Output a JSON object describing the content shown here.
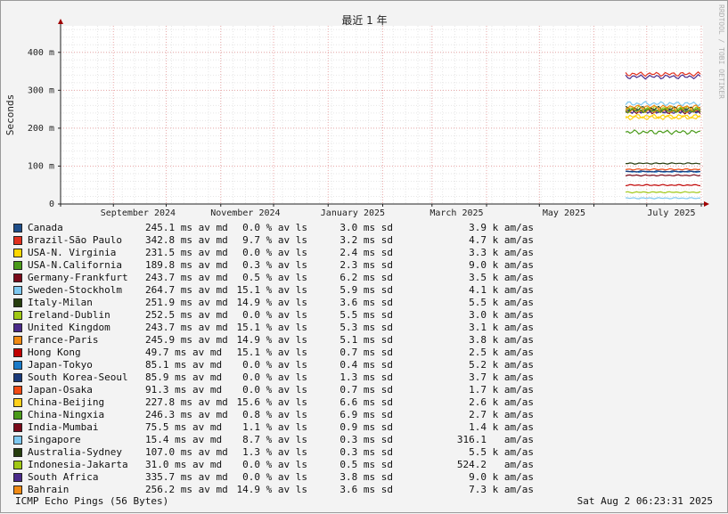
{
  "chart_data": {
    "type": "line",
    "title": "最近 1 年",
    "ylabel": "Seconds",
    "watermark": "RRDTOOL / TOBI OETIKER",
    "ylim": [
      0,
      0.47
    ],
    "yticks": [
      {
        "v": 0,
        "label": "0"
      },
      {
        "v": 0.1,
        "label": "100 m"
      },
      {
        "v": 0.2,
        "label": "200 m"
      },
      {
        "v": 0.3,
        "label": "300 m"
      },
      {
        "v": 0.4,
        "label": "400 m"
      }
    ],
    "xlim": [
      "2024-08-02",
      "2025-08-02"
    ],
    "xticks": [
      {
        "date": "2024-09-15",
        "label": "September 2024"
      },
      {
        "date": "2024-11-15",
        "label": "November 2024"
      },
      {
        "date": "2025-01-15",
        "label": "January 2025"
      },
      {
        "date": "2025-03-15",
        "label": "March 2025"
      },
      {
        "date": "2025-05-15",
        "label": "May 2025"
      },
      {
        "date": "2025-07-15",
        "label": "July 2025"
      }
    ],
    "data_start": "2025-06-19",
    "series": [
      {
        "name": "Canada",
        "color": "#1f4e8a",
        "value": 0.2451
      },
      {
        "name": "Brazil-São Paulo",
        "color": "#e0301e",
        "value": 0.3428
      },
      {
        "name": "USA-N. Virginia",
        "color": "#ffd700",
        "value": 0.2315
      },
      {
        "name": "USA-N.California",
        "color": "#4a9a1a",
        "value": 0.1898
      },
      {
        "name": "Germany-Frankfurt",
        "color": "#7a0a1a",
        "value": 0.2437
      },
      {
        "name": "Sweden-Stockholm",
        "color": "#7ec8f0",
        "value": 0.2647
      },
      {
        "name": "Italy-Milan",
        "color": "#263d0e",
        "value": 0.2519
      },
      {
        "name": "Ireland-Dublin",
        "color": "#a0c814",
        "value": 0.2525
      },
      {
        "name": "United Kingdom",
        "color": "#4a2a8a",
        "value": 0.2437
      },
      {
        "name": "France-Paris",
        "color": "#f08a14",
        "value": 0.2459
      },
      {
        "name": "Hong Kong",
        "color": "#c00000",
        "value": 0.0497
      },
      {
        "name": "Japan-Tokyo",
        "color": "#1a7ac8",
        "value": 0.0851
      },
      {
        "name": "South Korea-Seoul",
        "color": "#1a3a7a",
        "value": 0.0859
      },
      {
        "name": "Japan-Osaka",
        "color": "#f04a14",
        "value": 0.0913
      },
      {
        "name": "China-Beijing",
        "color": "#ffd01a",
        "value": 0.2278
      },
      {
        "name": "China-Ningxia",
        "color": "#4a9a1a",
        "value": 0.2463
      },
      {
        "name": "India-Mumbai",
        "color": "#7a0a1a",
        "value": 0.0755
      },
      {
        "name": "Singapore",
        "color": "#7ec8f0",
        "value": 0.0154
      },
      {
        "name": "Australia-Sydney",
        "color": "#263d0e",
        "value": 0.107
      },
      {
        "name": "Indonesia-Jakarta",
        "color": "#a0c814",
        "value": 0.031
      },
      {
        "name": "South Africa",
        "color": "#4a2a8a",
        "value": 0.3357
      },
      {
        "name": "Bahrain",
        "color": "#f08a14",
        "value": 0.2562
      }
    ]
  },
  "legend": [
    {
      "name": "Canada",
      "median": "245.1 ms av md",
      "loss": "0.0 % av ls",
      "sd": "3.0 ms sd",
      "amas": "3.9 k am/as"
    },
    {
      "name": "Brazil-São Paulo",
      "median": "342.8 ms av md",
      "loss": "9.7 % av ls",
      "sd": "3.2 ms sd",
      "amas": "4.7 k am/as"
    },
    {
      "name": "USA-N. Virginia",
      "median": "231.5 ms av md",
      "loss": "0.0 % av ls",
      "sd": "2.4 ms sd",
      "amas": "3.3 k am/as"
    },
    {
      "name": "USA-N.California",
      "median": "189.8 ms av md",
      "loss": "0.3 % av ls",
      "sd": "2.3 ms sd",
      "amas": "9.0 k am/as"
    },
    {
      "name": "Germany-Frankfurt",
      "median": "243.7 ms av md",
      "loss": "0.5 % av ls",
      "sd": "6.2 ms sd",
      "amas": "3.5 k am/as"
    },
    {
      "name": "Sweden-Stockholm",
      "median": "264.7 ms av md",
      "loss": "15.1 % av ls",
      "sd": "5.9 ms sd",
      "amas": "4.1 k am/as"
    },
    {
      "name": "Italy-Milan",
      "median": "251.9 ms av md",
      "loss": "14.9 % av ls",
      "sd": "3.6 ms sd",
      "amas": "5.5 k am/as"
    },
    {
      "name": "Ireland-Dublin",
      "median": "252.5 ms av md",
      "loss": "0.0 % av ls",
      "sd": "5.5 ms sd",
      "amas": "3.0 k am/as"
    },
    {
      "name": "United Kingdom",
      "median": "243.7 ms av md",
      "loss": "15.1 % av ls",
      "sd": "5.3 ms sd",
      "amas": "3.1 k am/as"
    },
    {
      "name": "France-Paris",
      "median": "245.9 ms av md",
      "loss": "14.9 % av ls",
      "sd": "5.1 ms sd",
      "amas": "3.8 k am/as"
    },
    {
      "name": "Hong Kong",
      "median": "49.7 ms av md",
      "loss": "15.1 % av ls",
      "sd": "0.7 ms sd",
      "amas": "2.5 k am/as"
    },
    {
      "name": "Japan-Tokyo",
      "median": "85.1 ms av md",
      "loss": "0.0 % av ls",
      "sd": "0.4 ms sd",
      "amas": "5.2 k am/as"
    },
    {
      "name": "South Korea-Seoul",
      "median": "85.9 ms av md",
      "loss": "0.0 % av ls",
      "sd": "1.3 ms sd",
      "amas": "3.7 k am/as"
    },
    {
      "name": "Japan-Osaka",
      "median": "91.3 ms av md",
      "loss": "0.0 % av ls",
      "sd": "0.7 ms sd",
      "amas": "1.7 k am/as"
    },
    {
      "name": "China-Beijing",
      "median": "227.8 ms av md",
      "loss": "15.6 % av ls",
      "sd": "6.6 ms sd",
      "amas": "2.6 k am/as"
    },
    {
      "name": "China-Ningxia",
      "median": "246.3 ms av md",
      "loss": "0.8 % av ls",
      "sd": "6.9 ms sd",
      "amas": "2.7 k am/as"
    },
    {
      "name": "India-Mumbai",
      "median": "75.5 ms av md",
      "loss": "1.1 % av ls",
      "sd": "0.9 ms sd",
      "amas": "1.4 k am/as"
    },
    {
      "name": "Singapore",
      "median": "15.4 ms av md",
      "loss": "8.7 % av ls",
      "sd": "0.3 ms sd",
      "amas": "316.1   am/as"
    },
    {
      "name": "Australia-Sydney",
      "median": "107.0 ms av md",
      "loss": "1.3 % av ls",
      "sd": "0.3 ms sd",
      "amas": "5.5 k am/as"
    },
    {
      "name": "Indonesia-Jakarta",
      "median": "31.0 ms av md",
      "loss": "0.0 % av ls",
      "sd": "0.5 ms sd",
      "amas": "524.2   am/as"
    },
    {
      "name": "South Africa",
      "median": "335.7 ms av md",
      "loss": "0.0 % av ls",
      "sd": "3.8 ms sd",
      "amas": "9.0 k am/as"
    },
    {
      "name": "Bahrain",
      "median": "256.2 ms av md",
      "loss": "14.9 % av ls",
      "sd": "3.6 ms sd",
      "amas": "7.3 k am/as"
    }
  ],
  "footer": {
    "left": "ICMP Echo Pings (56 Bytes)",
    "right": "Sat Aug  2 06:23:31 2025"
  }
}
